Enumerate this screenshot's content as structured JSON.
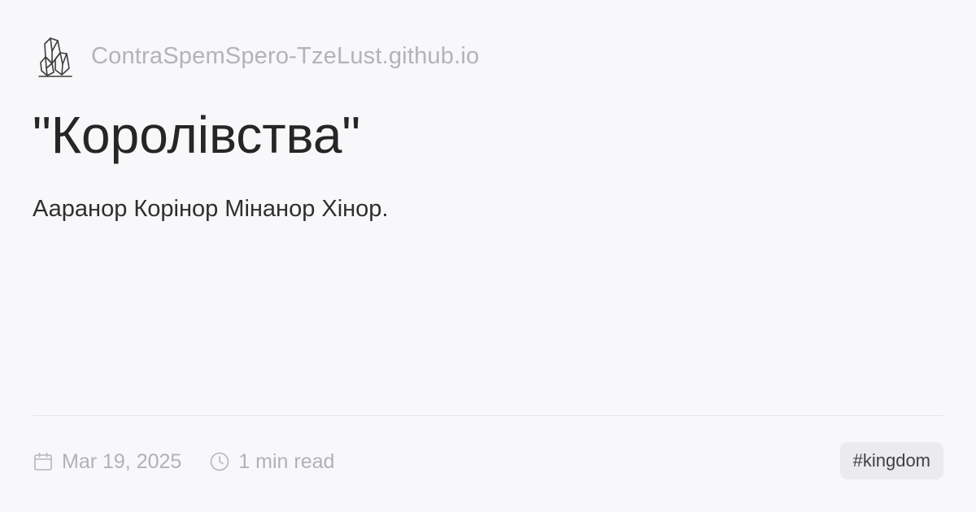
{
  "site": {
    "logo_icon": "crystal-cluster-icon",
    "name": "ContraSpemSpero-TzeLust.github.io"
  },
  "post": {
    "title": "\"Королівства\"",
    "description": "Ааранор Корінор Мінанор Хінор.",
    "date": "Mar 19, 2025",
    "read_time": "1 min read",
    "tag": "#kingdom"
  },
  "icons": {
    "date": "calendar-icon",
    "read_time": "clock-icon"
  },
  "colors": {
    "background": "#f8f7f9",
    "muted_text": "#b4b4b7",
    "title_text": "#262626",
    "tag_background": "#ebebee"
  }
}
